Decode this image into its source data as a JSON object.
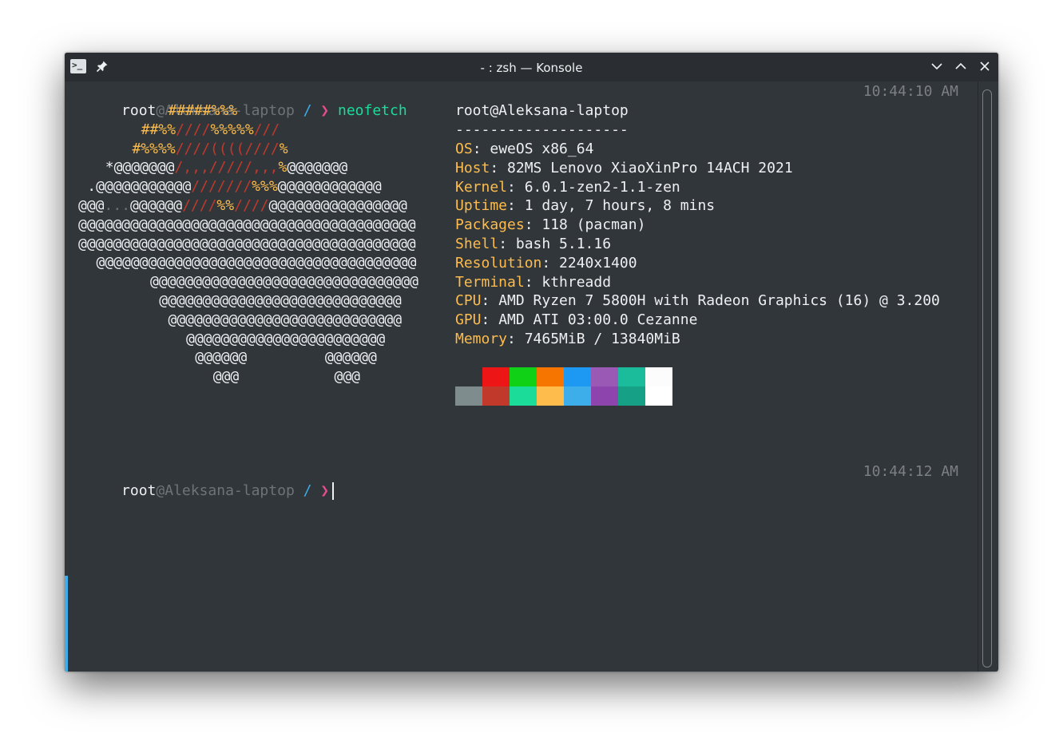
{
  "window": {
    "title": "- : zsh — Konsole",
    "app_icon_glyph": ">_",
    "pin_glyph": "📌",
    "minimize_glyph": "⌄",
    "maximize_glyph": "⌃",
    "close_glyph": "✕"
  },
  "prompt1": {
    "user": "root",
    "host": "@Aleksana-laptop",
    "cwd": " / ",
    "arrow": "❯ ",
    "command": "neofetch",
    "time": "10:44:10 AM"
  },
  "logo": [
    [
      [
        "#####%%%",
        "o"
      ]
    ],
    [
      [
        "##%%",
        "o"
      ],
      [
        "////",
        "r"
      ],
      [
        "%%%%%",
        "o"
      ],
      [
        "///",
        "r"
      ]
    ],
    [
      [
        "#%%%%",
        "o"
      ],
      [
        "////((((////",
        "r"
      ],
      [
        "%",
        "o"
      ]
    ],
    [
      [
        "*@@@@@@@",
        "w"
      ],
      [
        "/,,,/////,,,",
        "r"
      ],
      [
        "%",
        "o"
      ],
      [
        "@@@@@@@",
        "w"
      ]
    ],
    [
      [
        ".@@@@@@@@@@@",
        "w"
      ],
      [
        "///////",
        "r"
      ],
      [
        "%%%",
        "o"
      ],
      [
        "@@@@@@@@@@@@",
        "w"
      ]
    ],
    [
      [
        "@@@",
        "w"
      ],
      [
        "...",
        "d"
      ],
      [
        "@@@@@@",
        "w"
      ],
      [
        "////",
        "r"
      ],
      [
        "%%",
        "o"
      ],
      [
        "////",
        "r"
      ],
      [
        "@@@@@@@@@@@@@@@@",
        "w"
      ]
    ],
    [
      [
        "@@@@@@@@@@@@@@@@@@@@@@@@@@@@@@@@@@@@@@@",
        "w"
      ]
    ],
    [
      [
        "@@@@@@@@@@@@@@@@@@@@@@@@@@@@@@@@@@@@@@@",
        "w"
      ]
    ],
    [
      [
        "@@@@@@@@@@@@@@@@@@@@@@@@@@@@@@@@@@@@@",
        "w"
      ]
    ],
    [
      [
        "@@@@@@@@@@@@@@@@@@@@@@@@@@@@@@@",
        "w"
      ]
    ],
    [
      [
        "@@@@@@@@@@@@@@@@@@@@@@@@@@@@",
        "w"
      ]
    ],
    [
      [
        "@@@@@@@@@@@@@@@@@@@@@@@@@@@",
        "w"
      ]
    ],
    [
      [
        "@@@@@@@@@@@@@@@@@@@@@@@",
        "w"
      ]
    ],
    [
      [
        "@@@@@@",
        "w"
      ],
      [
        "         ",
        "w"
      ],
      [
        "@@@@@@",
        "w"
      ]
    ],
    [
      [
        "@@@",
        "w"
      ],
      [
        "           ",
        "w"
      ],
      [
        "@@@",
        "w"
      ]
    ]
  ],
  "logo_indent": [
    10,
    7,
    6,
    3,
    1,
    0,
    0,
    0,
    2,
    8,
    9,
    10,
    12,
    13,
    15
  ],
  "info": {
    "user_host": "root@Aleksana-laptop",
    "separator": "--------------------",
    "fields": [
      {
        "label": "OS",
        "value": ": eweOS x86_64"
      },
      {
        "label": "Host",
        "value": ": 82MS Lenovo XiaoXinPro 14ACH 2021"
      },
      {
        "label": "Kernel",
        "value": ": 6.0.1-zen2-1.1-zen"
      },
      {
        "label": "Uptime",
        "value": ": 1 day, 7 hours, 8 mins"
      },
      {
        "label": "Packages",
        "value": ": 118 (pacman)"
      },
      {
        "label": "Shell",
        "value": ": bash 5.1.16"
      },
      {
        "label": "Resolution",
        "value": ": 2240x1400"
      },
      {
        "label": "Terminal",
        "value": ": kthreadd"
      },
      {
        "label": "CPU",
        "value": ": AMD Ryzen 7 5800H with Radeon Graphics (16) @ 3.200"
      },
      {
        "label": "GPU",
        "value": ": AMD ATI 03:00.0 Cezanne"
      },
      {
        "label": "Memory",
        "value": ": 7465MiB / 13840MiB"
      }
    ]
  },
  "palette": {
    "row1": [
      "#31363b",
      "#ed1515",
      "#11d116",
      "#f67400",
      "#1d99f3",
      "#9b59b6",
      "#1abc9c",
      "#fcfcfc"
    ],
    "row2": [
      "#7f8c8d",
      "#c0392b",
      "#1cdc9a",
      "#fdbc4b",
      "#3daee9",
      "#8e44ad",
      "#16a085",
      "#ffffff"
    ]
  },
  "prompt2": {
    "user": "root",
    "host": "@Aleksana-laptop",
    "cwd": " / ",
    "arrow": "❯",
    "time": "10:44:12 AM"
  }
}
